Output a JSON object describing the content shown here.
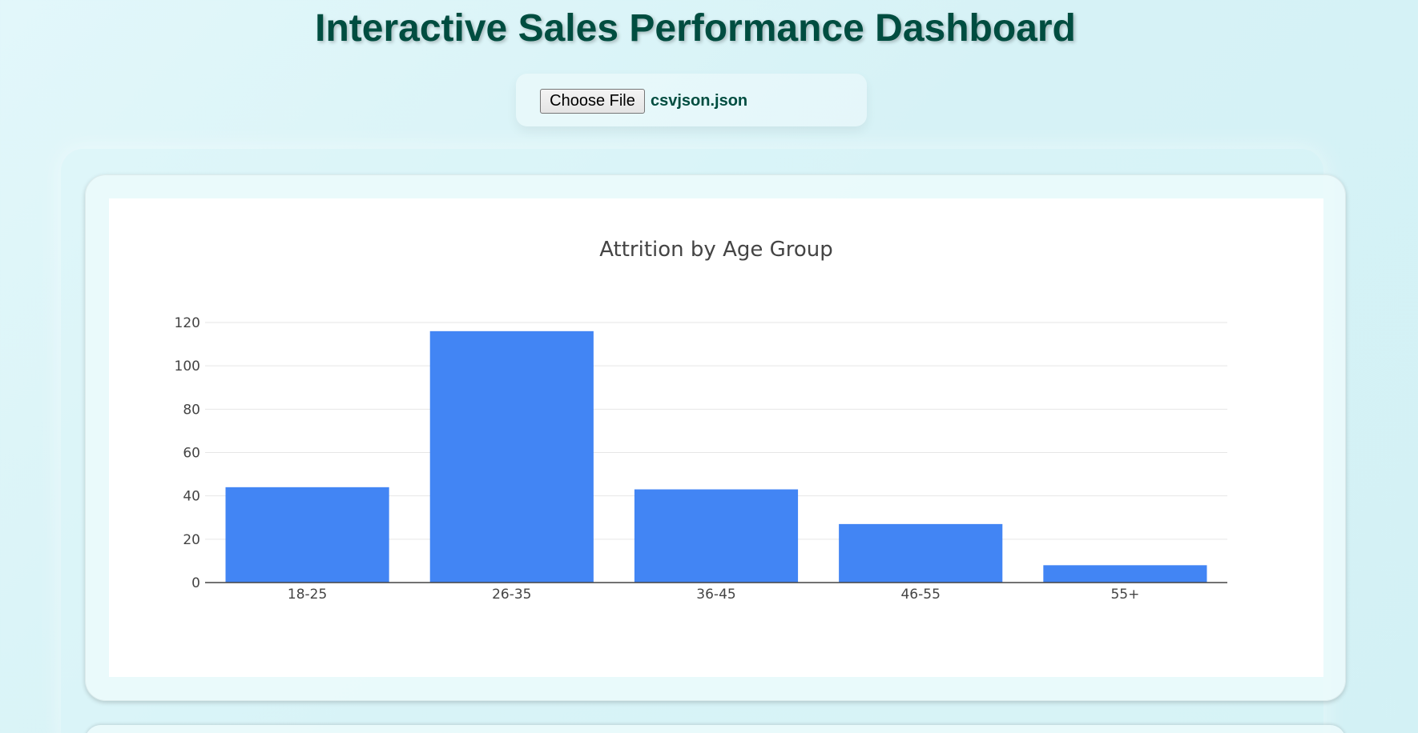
{
  "page": {
    "title": "Interactive Sales Performance Dashboard"
  },
  "upload": {
    "button_label": "Choose File",
    "file_name": "csvjson.json"
  },
  "colors": {
    "title": "#004d40",
    "bar": "#4285f4"
  },
  "chart_data": {
    "type": "bar",
    "title": "Attrition by Age Group",
    "xlabel": "",
    "ylabel": "",
    "categories": [
      "18-25",
      "26-35",
      "36-45",
      "46-55",
      "55+"
    ],
    "values": [
      44,
      116,
      43,
      27,
      8
    ],
    "ylim": [
      0,
      120
    ],
    "yticks": [
      0,
      20,
      40,
      60,
      80,
      100,
      120
    ],
    "grid": true,
    "legend": "none"
  }
}
